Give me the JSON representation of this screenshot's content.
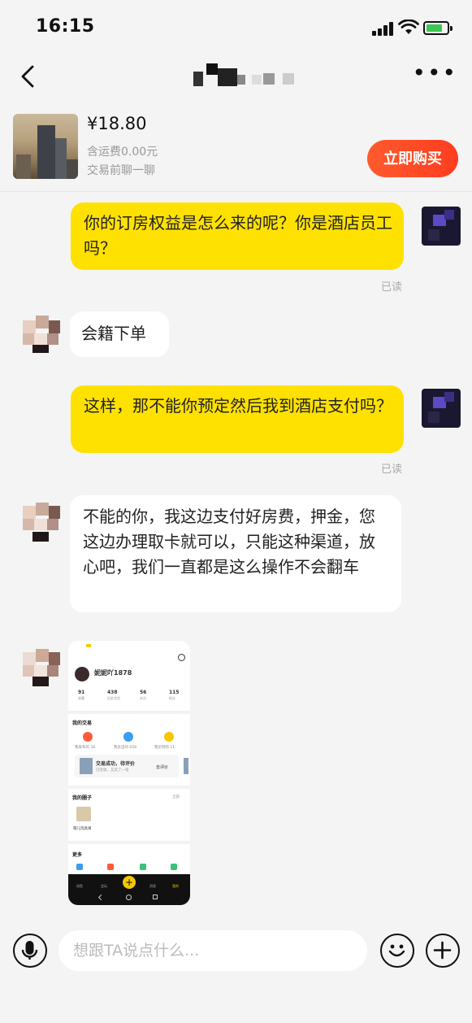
{
  "status_bar": {
    "time": "16:15"
  },
  "product": {
    "price": "¥18.80",
    "shipping": "含运费0.00元",
    "note": "交易前聊一聊",
    "buy_label": "立即购买"
  },
  "messages": [
    {
      "from": "me",
      "text": "你的订房权益是怎么来的呢？你是酒店员工吗？",
      "read": "已读"
    },
    {
      "from": "them",
      "text": "会籍下单"
    },
    {
      "from": "me",
      "text": " 这样，那不能你预定然后我到酒店支付吗？",
      "read": "已读"
    },
    {
      "from": "them",
      "text": "不能的你，我这边支付好房费，押金，您这边办理取卡就可以，只能这种渠道，放心吧，我们一直都是这么操作不会翻车"
    }
  ],
  "shared_screenshot": {
    "username": "妮妮吖1878",
    "stats": [
      {
        "value": "91",
        "label": "收藏"
      },
      {
        "value": "438",
        "label": "历史浏览"
      },
      {
        "value": "56",
        "label": "关注"
      },
      {
        "value": "115",
        "label": "粉丝"
      }
    ],
    "my_trades": "我的交易",
    "trade_items": [
      "我发布的 38",
      "我卖出的 658",
      "我买到的 11"
    ],
    "trade_msg": "交易成功，待评价",
    "trade_sub": "已签收，又卖了一笔",
    "trade_btn": "去评价",
    "my_circle": "我的圈子",
    "circle_all": "全部",
    "circle_name": "萌儿玩具窝",
    "more": "更多",
    "tabs": [
      "闲鱼",
      "会玩",
      "+",
      "消息",
      "我的"
    ]
  },
  "input": {
    "placeholder": "想跟TA说点什么..."
  },
  "icons": {
    "back": "chevron-left-icon",
    "more": "more-dots-icon",
    "voice": "microphone-icon",
    "emoji": "smiley-icon",
    "plus": "plus-icon"
  },
  "colors": {
    "my_bubble": "#ffe100",
    "buy_button": "#ff4a26",
    "battery": "#3bc751"
  }
}
